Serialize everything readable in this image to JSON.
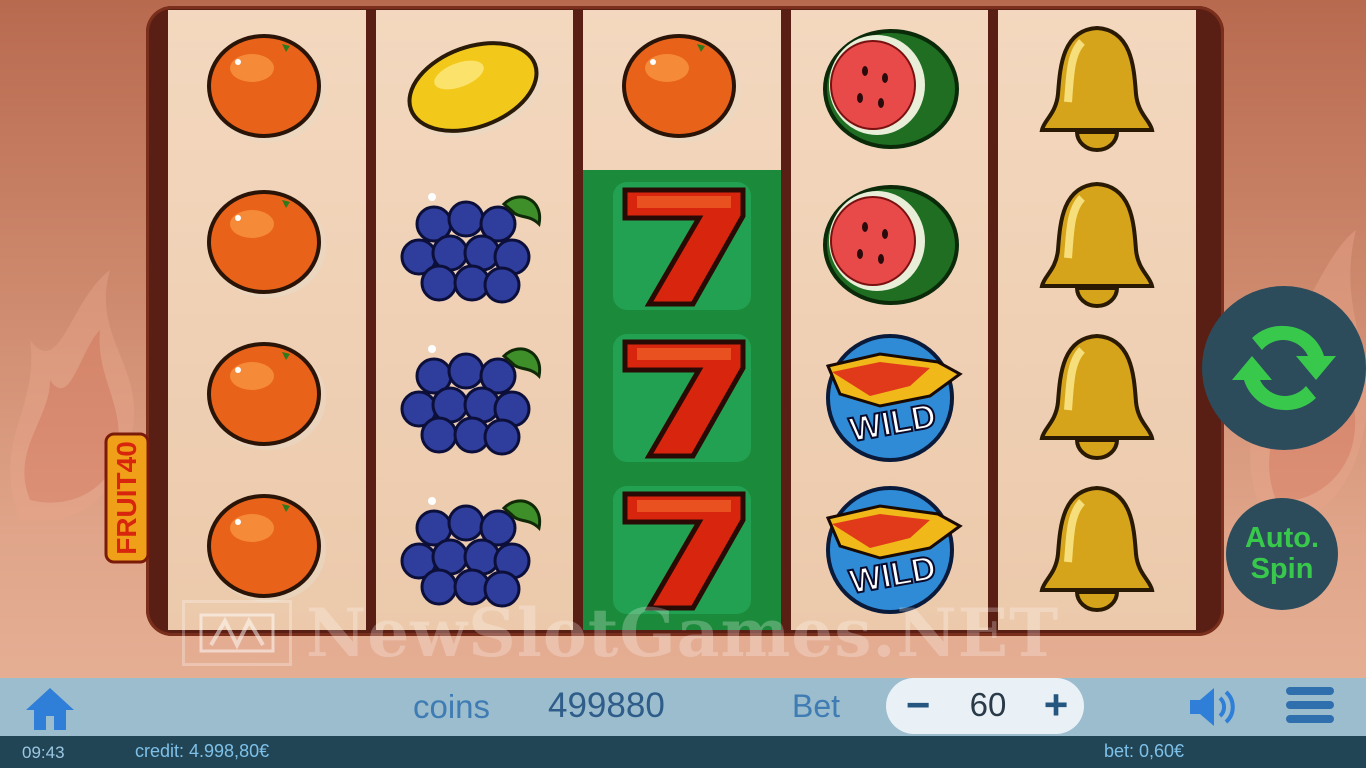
{
  "game": {
    "logo_text": "FRUIT40",
    "watermark": "NewSlotGames.NET"
  },
  "reels": [
    [
      "orange",
      "orange",
      "orange",
      "orange"
    ],
    [
      "lemon",
      "grapes",
      "grapes",
      "grapes"
    ],
    [
      "orange",
      "seven",
      "seven",
      "seven"
    ],
    [
      "watermelon",
      "watermelon",
      "wild",
      "wild"
    ],
    [
      "bell",
      "bell",
      "bell",
      "bell"
    ]
  ],
  "wild_label": "WILD",
  "buttons": {
    "auto_spin_line1": "Auto.",
    "auto_spin_line2": "Spin",
    "spin_icon": "refresh-icon",
    "home_icon": "home-icon",
    "sound_icon": "speaker-icon",
    "menu_icon": "hamburger-icon"
  },
  "bar": {
    "coins_label": "coins",
    "coins_value": "499880",
    "bet_label": "Bet",
    "bet_minus": "−",
    "bet_value": "60",
    "bet_plus": "+"
  },
  "status": {
    "time": "09:43",
    "credit": "credit: 4.998,80€",
    "bet": "bet: 0,60€"
  },
  "colors": {
    "spin_green": "#38c94c",
    "button_bg": "#2c4b5b",
    "highlight_reel": "#1b8a3a"
  }
}
